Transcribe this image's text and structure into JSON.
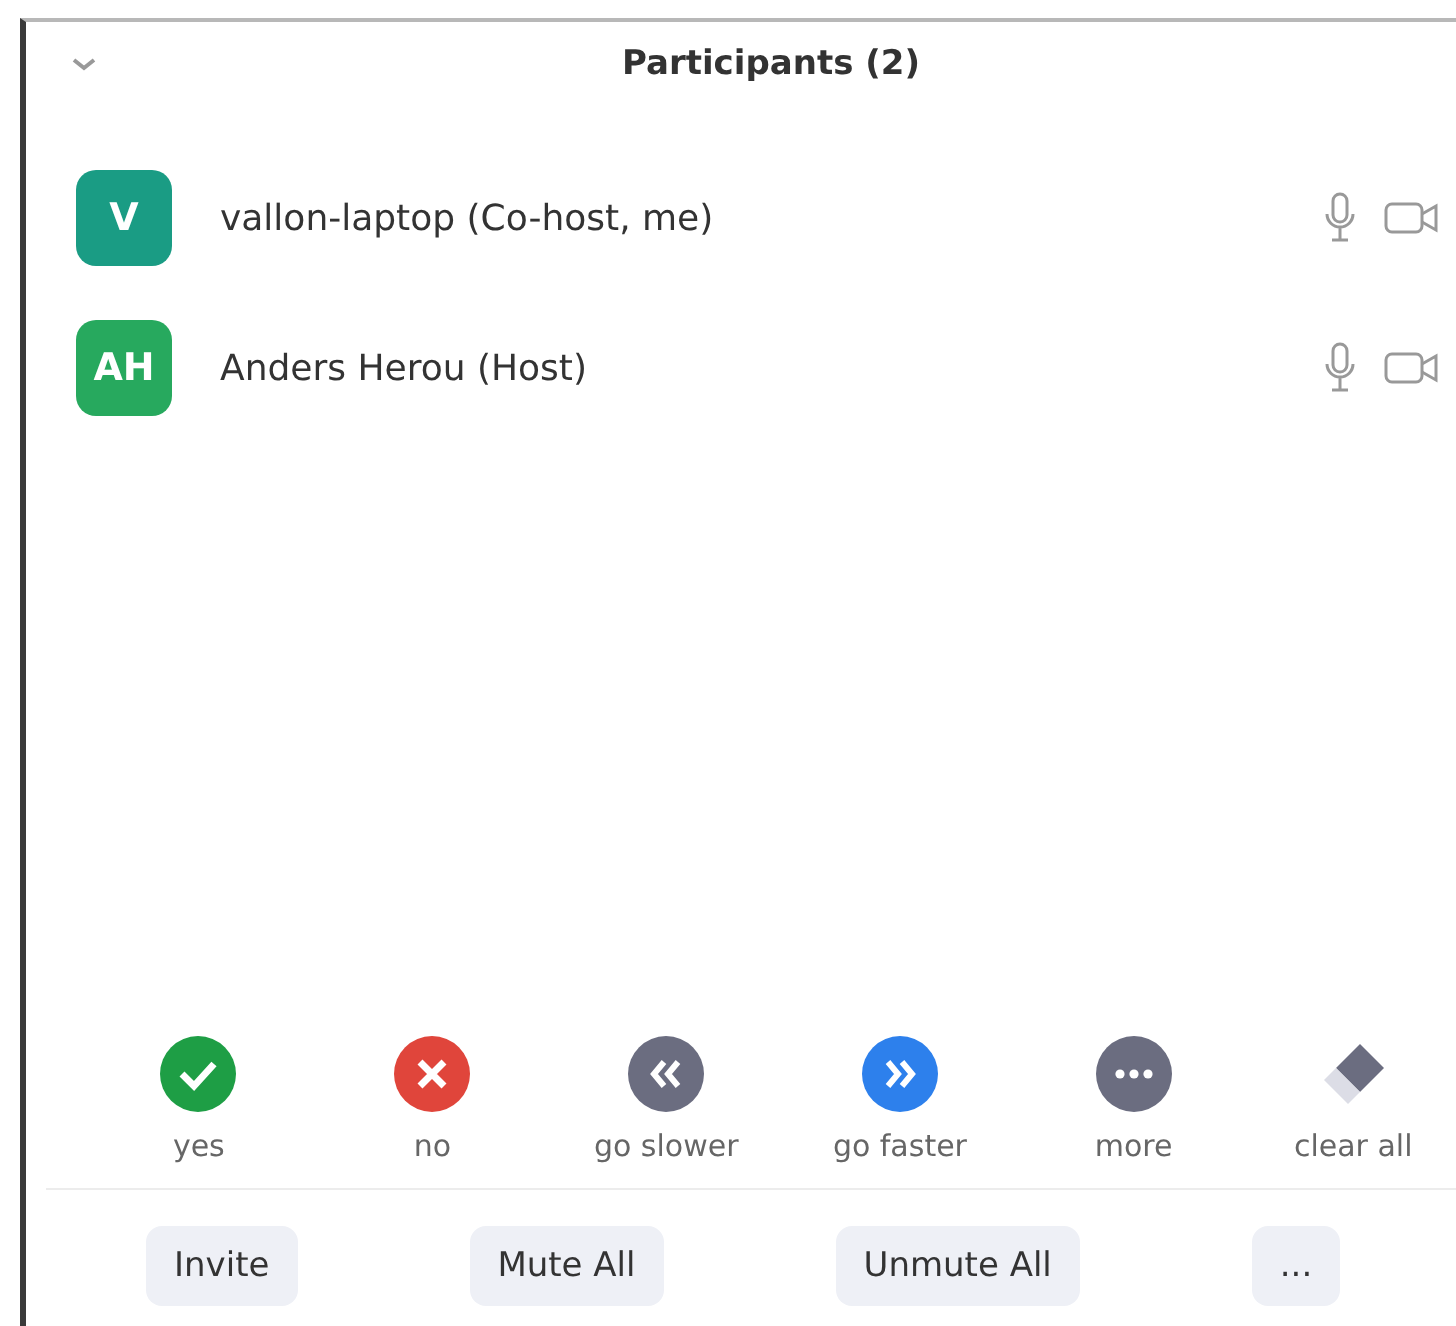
{
  "panel": {
    "title": "Participants (2)"
  },
  "participants": [
    {
      "initials": "V",
      "name": "vallon-laptop (Co-host, me)",
      "color": "#1a9c84"
    },
    {
      "initials": "AH",
      "name": "Anders Herou (Host)",
      "color": "#27a95e"
    }
  ],
  "reactions": [
    {
      "kind": "yes",
      "label": "yes",
      "color": "#1e9e45"
    },
    {
      "kind": "no",
      "label": "no",
      "color": "#e0453b"
    },
    {
      "kind": "slower",
      "label": "go slower",
      "color": "#6b6d80"
    },
    {
      "kind": "faster",
      "label": "go faster",
      "color": "#2d80ec"
    },
    {
      "kind": "more",
      "label": "more",
      "color": "#6b6d80"
    },
    {
      "kind": "clear",
      "label": "clear all",
      "color": "#6b6d80"
    }
  ],
  "buttons": [
    "Invite",
    "Mute All",
    "Unmute All",
    "..."
  ]
}
